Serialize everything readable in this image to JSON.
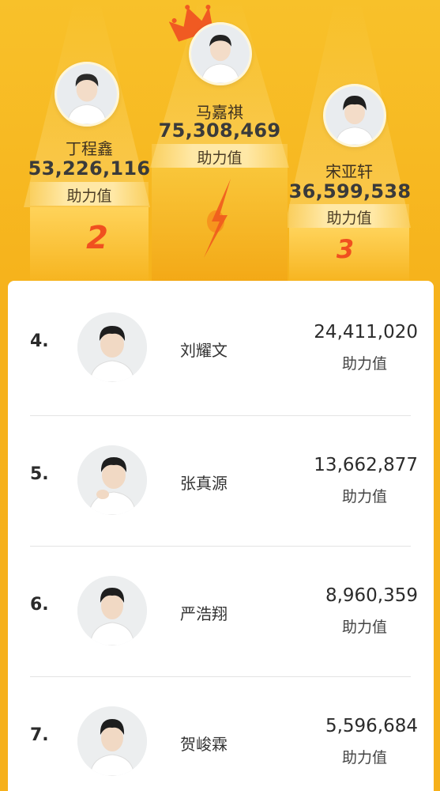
{
  "top3": [
    {
      "rank": "2",
      "name": "丁程鑫",
      "score": "53,226,116",
      "label": "助力值"
    },
    {
      "rank": "1",
      "name": "马嘉祺",
      "score": "75,308,469",
      "label": "助力值"
    },
    {
      "rank": "3",
      "name": "宋亚轩",
      "score": "36,599,538",
      "label": "助力值"
    }
  ],
  "list": [
    {
      "rank": "4.",
      "name": "刘耀文",
      "score": "24,411,020",
      "label": "助力值"
    },
    {
      "rank": "5.",
      "name": "张真源",
      "score": "13,662,877",
      "label": "助力值"
    },
    {
      "rank": "6.",
      "name": "严浩翔",
      "score": "8,960,359",
      "label": "助力值"
    },
    {
      "rank": "7.",
      "name": "贺峻霖",
      "score": "5,596,684",
      "label": "助力值"
    }
  ],
  "colors": {
    "background": "#f6b31d",
    "rank_accent": "#f0501f",
    "crown": "#f05a22",
    "card": "#ffffff"
  }
}
